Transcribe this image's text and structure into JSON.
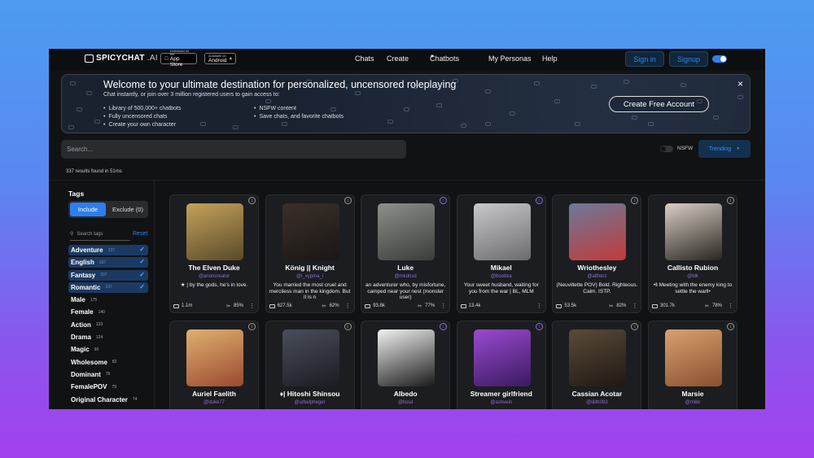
{
  "nav": {
    "brand": "SPICYCHAT",
    "brand_suffix": ".AI",
    "app_store_small": "Download on the",
    "app_store_big": "App Store",
    "android_small": "Available on",
    "android_big": "Android",
    "links": [
      "Chats",
      "Create",
      "Chatbots",
      "My Personas",
      "Help"
    ],
    "signin": "Sign in",
    "signup": "Signup"
  },
  "banner": {
    "title": "Welcome to your ultimate destination for personalized, uncensored roleplaying",
    "subtitle": "Chat instantly, or join over 3 million registered users to gain access to:",
    "features_left": [
      "Library of 500,000+ chatbots",
      "Fully uncensored chats",
      "Create your own character"
    ],
    "features_right": [
      "NSFW content",
      "Save chats, and favorite chatbots"
    ],
    "cta": "Create Free Account",
    "close": "×"
  },
  "search": {
    "placeholder": "Search..."
  },
  "filters": {
    "nsfw_label": "NSFW",
    "sort": "Trending"
  },
  "results_text": "337 results found in 51ms",
  "sidebar": {
    "title": "Tags",
    "include": "Include",
    "exclude": "Exclude (0)",
    "search_placeholder": "Search tags",
    "reset": "Reset",
    "tags": [
      {
        "name": "Adventure",
        "count": "337",
        "selected": true
      },
      {
        "name": "English",
        "count": "337",
        "selected": true
      },
      {
        "name": "Fantasy",
        "count": "337",
        "selected": true
      },
      {
        "name": "Romantic",
        "count": "337",
        "selected": true
      },
      {
        "name": "Male",
        "count": "175",
        "selected": false
      },
      {
        "name": "Female",
        "count": "140",
        "selected": false
      },
      {
        "name": "Action",
        "count": "133",
        "selected": false
      },
      {
        "name": "Drama",
        "count": "124",
        "selected": false
      },
      {
        "name": "Magic",
        "count": "90",
        "selected": false
      },
      {
        "name": "Wholesome",
        "count": "82",
        "selected": false
      },
      {
        "name": "Dominant",
        "count": "76",
        "selected": false
      },
      {
        "name": "FemalePOV",
        "count": "79",
        "selected": false
      },
      {
        "name": "Original Character",
        "count": "74",
        "selected": false
      }
    ]
  },
  "cards": [
    {
      "name": "The Elven Duke",
      "author": "@anoncreator",
      "desc": "★ | by the gods, he's in love.",
      "chats": "1.1m",
      "rating": "85%",
      "purple": false,
      "colors": [
        "#c4a25a",
        "#5a4a2a"
      ]
    },
    {
      "name": "König || Knight",
      "author": "@i_xypma_i",
      "desc": "You married the most cruel and merciless man in the kingdom. But it is n",
      "chats": "627.5k",
      "rating": "62%",
      "purple": false,
      "colors": [
        "#3a302a",
        "#1a1614"
      ]
    },
    {
      "name": "Luke",
      "author": "@mkdnsd",
      "desc": "an adventurer who, by misfortune, camped near your nest (monster user)",
      "chats": "93.8k",
      "rating": "77%",
      "purple": true,
      "colors": [
        "#8d8f8a",
        "#3a3c38"
      ]
    },
    {
      "name": "Mikael",
      "author": "@boobka",
      "desc": "Your sweet husband, waiting for you from the war | BL, MLM",
      "chats": "13.4k",
      "rating": "",
      "purple": true,
      "colors": [
        "#c9c9cc",
        "#6a6a70"
      ]
    },
    {
      "name": "Wriothesley",
      "author": "@altherz",
      "desc": "(Neuvillette POV) Bold. Righteous. Calm. ISTP.",
      "chats": "53.5k",
      "rating": "82%",
      "purple": false,
      "colors": [
        "#6b7a9a",
        "#c23a3a"
      ]
    },
    {
      "name": "Callisto Rubion",
      "author": "@blk",
      "desc": "•‖ Meeting with the enemy king to settle the war‖•",
      "chats": "301.7k",
      "rating": "78%",
      "purple": false,
      "colors": [
        "#d8cfc4",
        "#2a2622"
      ]
    },
    {
      "name": "Auriel Faelith",
      "author": "@duke77",
      "desc": "",
      "chats": "",
      "rating": "",
      "purple": false,
      "colors": [
        "#e0b070",
        "#9a4a30"
      ]
    },
    {
      "name": "♦| Hitoshi Shinsou",
      "author": "@urbelpheger",
      "desc": "",
      "chats": "",
      "rating": "",
      "purple": false,
      "colors": [
        "#4a4e5a",
        "#1a1c22"
      ]
    },
    {
      "name": "Albedo",
      "author": "@llusd",
      "desc": "",
      "chats": "",
      "rating": "",
      "purple": true,
      "colors": [
        "#f2f2f2",
        "#1a1a1a"
      ]
    },
    {
      "name": "Streamer girlfriend",
      "author": "@ashvein",
      "desc": "",
      "chats": "",
      "rating": "",
      "purple": true,
      "colors": [
        "#9a4ad0",
        "#3a1a60"
      ]
    },
    {
      "name": "Cassian Acotar",
      "author": "@lilith093",
      "desc": "",
      "chats": "",
      "rating": "",
      "purple": false,
      "colors": [
        "#5a4a3a",
        "#201812"
      ]
    },
    {
      "name": "Marsie",
      "author": "@mikk",
      "desc": "",
      "chats": "",
      "rating": "",
      "purple": false,
      "colors": [
        "#d9a070",
        "#8a5030"
      ]
    }
  ],
  "icons": {
    "info": "info-icon",
    "messages": "messages-icon",
    "rating": "thumbs-icon",
    "menu": "more-icon"
  },
  "colors": {
    "accent": "#2d7ff0",
    "author": "#8a6fd8",
    "selected_tag": "#1b3a63"
  }
}
